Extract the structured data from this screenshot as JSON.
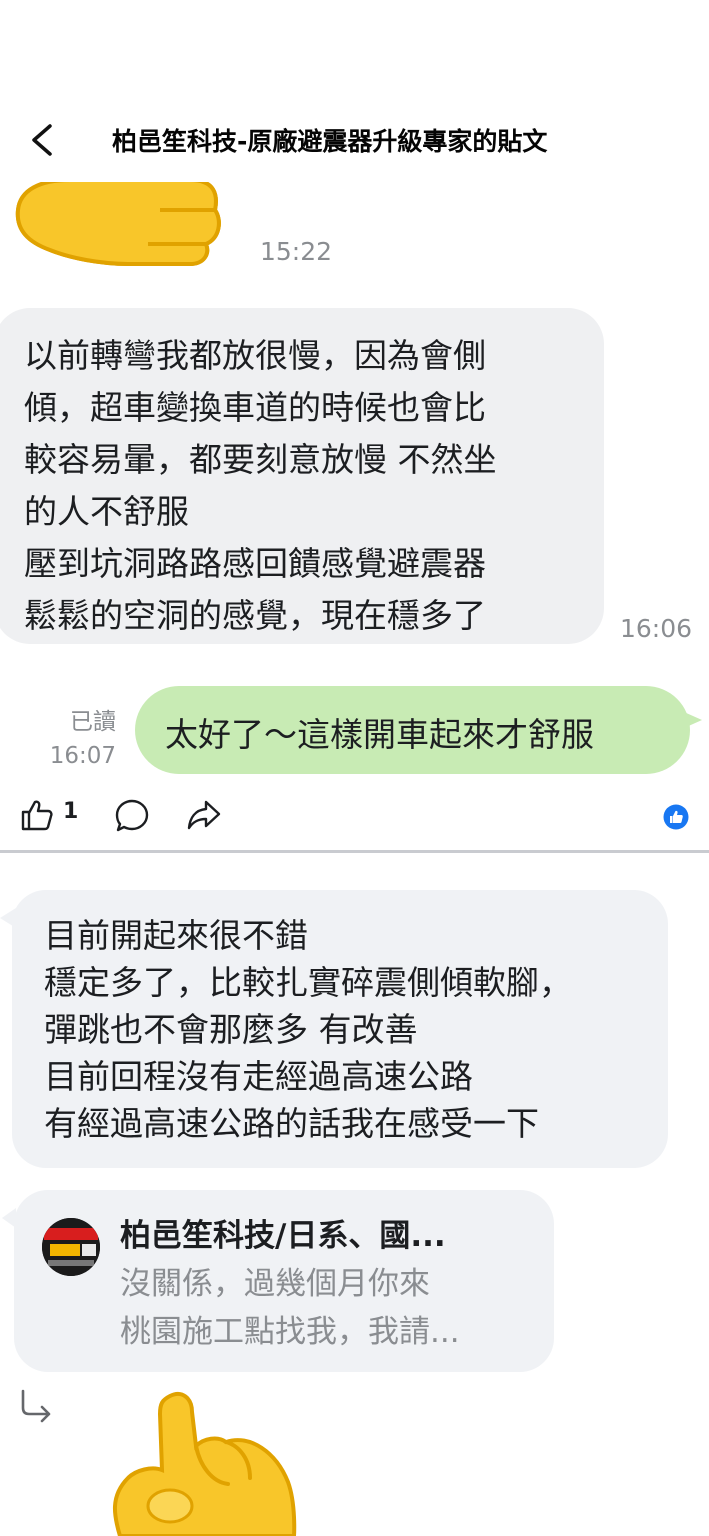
{
  "header": {
    "title": "柏邑笙科技-原廠避震器升級專家的貼文"
  },
  "chat": {
    "sticker1_time": "15:22",
    "received_message": {
      "lines": [
        "以前轉彎我都放很慢，因為會側",
        "傾，超車變換車道的時候也會比",
        "較容易暈，都要刻意放慢 不然坐",
        "的人不舒服",
        "壓到坑洞路路感回饋感覺避震器",
        "鬆鬆的空洞的感覺，現在穩多了"
      ],
      "time": "16:06"
    },
    "sent_message": {
      "text": "太好了～這樣開車起來才舒服",
      "read_label": "已讀",
      "time": "16:07"
    }
  },
  "actions": {
    "like_count": "1",
    "like_icon": "thumbs-up-icon",
    "comment_icon": "comment-icon",
    "share_icon": "share-icon",
    "reaction_icon": "like-reaction-icon"
  },
  "comments": {
    "comment1": {
      "lines": [
        "目前開起來很不錯",
        "穩定多了，比較扎實碎震側傾軟腳，",
        "彈跳也不會那麼多 有改善",
        "目前回程沒有走經過高速公路",
        "有經過高速公路的話我在感受一下"
      ]
    },
    "reply_quote": {
      "name": "柏邑笙科技/日系、國...",
      "lines": [
        "沒關係，過幾個月你來",
        "桃園施工點找我，我請..."
      ]
    }
  },
  "colors": {
    "received_bubble": "#eff0f2",
    "sent_bubble": "#c8ebb4",
    "facebook_blue": "#1877f2",
    "emoji_yellow": "#f8c62a"
  }
}
